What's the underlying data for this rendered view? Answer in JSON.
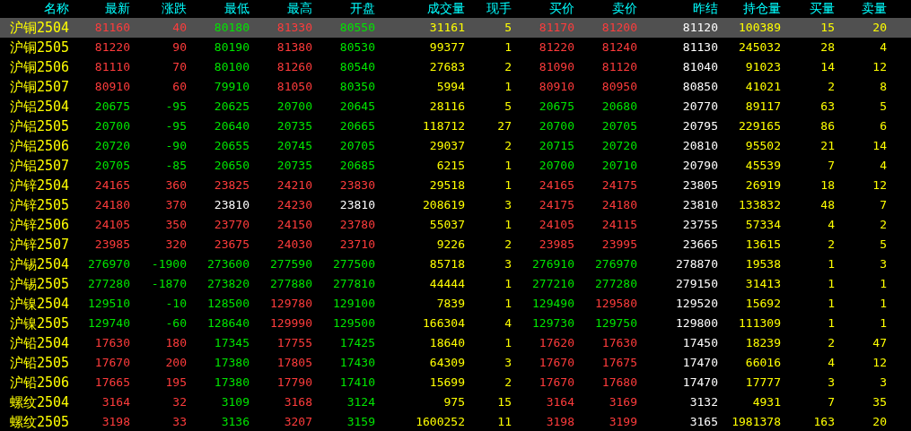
{
  "columns": [
    {
      "label": "名称",
      "kind": "name"
    },
    {
      "label": "最新",
      "kind": "price"
    },
    {
      "label": "涨跌",
      "kind": "change"
    },
    {
      "label": "最低",
      "kind": "price"
    },
    {
      "label": "最高",
      "kind": "price"
    },
    {
      "label": "开盘",
      "kind": "price"
    },
    {
      "label": "成交量",
      "kind": "volume"
    },
    {
      "label": "现手",
      "kind": "volume"
    },
    {
      "label": "买价",
      "kind": "price"
    },
    {
      "label": "卖价",
      "kind": "price"
    },
    {
      "label": "昨结",
      "kind": "close"
    },
    {
      "label": "持仓量",
      "kind": "volume"
    },
    {
      "label": "买量",
      "kind": "volume"
    },
    {
      "label": "卖量",
      "kind": "volume"
    }
  ],
  "rows": [
    {
      "selected": true,
      "cells": [
        "沪铜2504",
        "81160",
        "40",
        "80180",
        "81330",
        "80550",
        "31161",
        "5",
        "81170",
        "81200",
        "81120",
        "100389",
        "15",
        "20"
      ]
    },
    {
      "selected": false,
      "cells": [
        "沪铜2505",
        "81220",
        "90",
        "80190",
        "81380",
        "80530",
        "99377",
        "1",
        "81220",
        "81240",
        "81130",
        "245032",
        "28",
        "4"
      ]
    },
    {
      "selected": false,
      "cells": [
        "沪铜2506",
        "81110",
        "70",
        "80100",
        "81260",
        "80540",
        "27683",
        "2",
        "81090",
        "81120",
        "81040",
        "91023",
        "14",
        "12"
      ]
    },
    {
      "selected": false,
      "cells": [
        "沪铜2507",
        "80910",
        "60",
        "79910",
        "81050",
        "80350",
        "5994",
        "1",
        "80910",
        "80950",
        "80850",
        "41021",
        "2",
        "8"
      ]
    },
    {
      "selected": false,
      "cells": [
        "沪铝2504",
        "20675",
        "-95",
        "20625",
        "20700",
        "20645",
        "28116",
        "5",
        "20675",
        "20680",
        "20770",
        "89117",
        "63",
        "5"
      ]
    },
    {
      "selected": false,
      "cells": [
        "沪铝2505",
        "20700",
        "-95",
        "20640",
        "20735",
        "20665",
        "118712",
        "27",
        "20700",
        "20705",
        "20795",
        "229165",
        "86",
        "6"
      ]
    },
    {
      "selected": false,
      "cells": [
        "沪铝2506",
        "20720",
        "-90",
        "20655",
        "20745",
        "20705",
        "29037",
        "2",
        "20715",
        "20720",
        "20810",
        "95502",
        "21",
        "14"
      ]
    },
    {
      "selected": false,
      "cells": [
        "沪铝2507",
        "20705",
        "-85",
        "20650",
        "20735",
        "20685",
        "6215",
        "1",
        "20700",
        "20710",
        "20790",
        "45539",
        "7",
        "4"
      ]
    },
    {
      "selected": false,
      "cells": [
        "沪锌2504",
        "24165",
        "360",
        "23825",
        "24210",
        "23830",
        "29518",
        "1",
        "24165",
        "24175",
        "23805",
        "26919",
        "18",
        "12"
      ]
    },
    {
      "selected": false,
      "cells": [
        "沪锌2505",
        "24180",
        "370",
        "23810",
        "24230",
        "23810",
        "208619",
        "3",
        "24175",
        "24180",
        "23810",
        "133832",
        "48",
        "7"
      ]
    },
    {
      "selected": false,
      "cells": [
        "沪锌2506",
        "24105",
        "350",
        "23770",
        "24150",
        "23780",
        "55037",
        "1",
        "24105",
        "24115",
        "23755",
        "57334",
        "4",
        "2"
      ]
    },
    {
      "selected": false,
      "cells": [
        "沪锌2507",
        "23985",
        "320",
        "23675",
        "24030",
        "23710",
        "9226",
        "2",
        "23985",
        "23995",
        "23665",
        "13615",
        "2",
        "5"
      ]
    },
    {
      "selected": false,
      "cells": [
        "沪锡2504",
        "276970",
        "-1900",
        "273600",
        "277590",
        "277500",
        "85718",
        "3",
        "276910",
        "276970",
        "278870",
        "19538",
        "1",
        "3"
      ]
    },
    {
      "selected": false,
      "cells": [
        "沪锡2505",
        "277280",
        "-1870",
        "273820",
        "277880",
        "277810",
        "44444",
        "1",
        "277210",
        "277280",
        "279150",
        "31413",
        "1",
        "1"
      ]
    },
    {
      "selected": false,
      "cells": [
        "沪镍2504",
        "129510",
        "-10",
        "128500",
        "129780",
        "129100",
        "7839",
        "1",
        "129490",
        "129580",
        "129520",
        "15692",
        "1",
        "1"
      ]
    },
    {
      "selected": false,
      "cells": [
        "沪镍2505",
        "129740",
        "-60",
        "128640",
        "129990",
        "129500",
        "166304",
        "4",
        "129730",
        "129750",
        "129800",
        "111309",
        "1",
        "1"
      ]
    },
    {
      "selected": false,
      "cells": [
        "沪铅2504",
        "17630",
        "180",
        "17345",
        "17755",
        "17425",
        "18640",
        "1",
        "17620",
        "17630",
        "17450",
        "18239",
        "2",
        "47"
      ]
    },
    {
      "selected": false,
      "cells": [
        "沪铅2505",
        "17670",
        "200",
        "17380",
        "17805",
        "17430",
        "64309",
        "3",
        "17670",
        "17675",
        "17470",
        "66016",
        "4",
        "12"
      ]
    },
    {
      "selected": false,
      "cells": [
        "沪铅2506",
        "17665",
        "195",
        "17380",
        "17790",
        "17410",
        "15699",
        "2",
        "17670",
        "17680",
        "17470",
        "17777",
        "3",
        "3"
      ]
    },
    {
      "selected": false,
      "cells": [
        "螺纹2504",
        "3164",
        "32",
        "3109",
        "3168",
        "3124",
        "975",
        "15",
        "3164",
        "3169",
        "3132",
        "4931",
        "7",
        "35"
      ]
    },
    {
      "selected": false,
      "cells": [
        "螺纹2505",
        "3198",
        "33",
        "3136",
        "3207",
        "3159",
        "1600252",
        "11",
        "3198",
        "3199",
        "3165",
        "1981378",
        "163",
        "20"
      ]
    }
  ]
}
